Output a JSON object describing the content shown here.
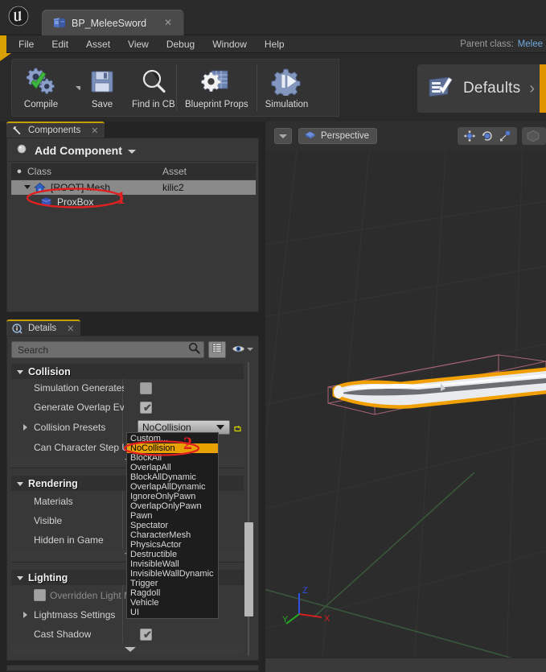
{
  "window": {
    "logo_icon": "unreal-engine-logo",
    "tab": {
      "label": "BP_MeleeSword",
      "icon": "blueprint-icon",
      "close_icon": "close-icon"
    }
  },
  "menubar": {
    "items": [
      {
        "label": "File"
      },
      {
        "label": "Edit"
      },
      {
        "label": "Asset"
      },
      {
        "label": "View"
      },
      {
        "label": "Debug"
      },
      {
        "label": "Window"
      },
      {
        "label": "Help"
      }
    ],
    "parent_class_label": "Parent class:",
    "parent_class_value": "Melee"
  },
  "toolbar": {
    "buttons": [
      {
        "label": "Compile",
        "icon": "compile-gears-check-icon"
      },
      {
        "label": "Save",
        "icon": "floppy-disk-icon"
      },
      {
        "label": "Find in CB",
        "icon": "magnifier-icon"
      },
      {
        "label": "Blueprint Props",
        "icon": "blueprint-properties-icon"
      },
      {
        "label": "Simulation",
        "icon": "simulation-gear-play-icon"
      }
    ],
    "defaults_label": "Defaults",
    "defaults_icon": "defaults-checklist-icon",
    "defaults_chevron": "›"
  },
  "components_panel": {
    "tab_label": "Components",
    "tab_icon": "wrench-icon",
    "close_icon": "close-icon",
    "add_component_label": "Add Component",
    "add_component_icon": "add-component-sphere-icon",
    "columns": {
      "class": "Class",
      "asset": "Asset"
    },
    "rows": [
      {
        "label": "[ROOT] Mesh",
        "asset": "kilic2",
        "icon": "mesh-home-icon",
        "selected": true,
        "indent": 0
      },
      {
        "label": "ProxBox",
        "asset": "",
        "icon": "box-collision-icon",
        "selected": false,
        "indent": 1
      }
    ]
  },
  "details_panel": {
    "tab_label": "Details",
    "tab_icon": "details-info-icon",
    "close_icon": "close-icon",
    "search": {
      "placeholder": "Search",
      "value": "",
      "icon": "search-icon"
    },
    "view_toggle_icon": "grid-view-icon",
    "visibility_icon": "eye-icon",
    "visibility_caret_icon": "chevron-down-icon",
    "categories": [
      {
        "title": "Collision",
        "properties": [
          {
            "label": "Simulation Generates I",
            "type": "checkbox",
            "checked": false
          },
          {
            "label": "Generate Overlap Even",
            "type": "checkbox",
            "checked": true
          },
          {
            "label": "Collision Presets",
            "type": "combo",
            "value": "NoCollision",
            "expandable": true,
            "reset_icon": "reset-arrow-icon"
          },
          {
            "label": "Can Character Step Up",
            "type": "none"
          }
        ]
      },
      {
        "title": "Rendering",
        "properties": [
          {
            "label": "Materials",
            "type": "none"
          },
          {
            "label": "Visible",
            "type": "none"
          },
          {
            "label": "Hidden in Game",
            "type": "none"
          }
        ]
      },
      {
        "title": "Lighting",
        "properties": [
          {
            "label": "Overridden Light M",
            "type": "checkbox",
            "checked": false,
            "dim": true
          },
          {
            "label": "Lightmass Settings",
            "type": "none",
            "expandable": true
          },
          {
            "label": "Cast Shadow",
            "type": "checkbox",
            "checked": true
          }
        ]
      }
    ]
  },
  "collision_dropdown": {
    "open": true,
    "selected": "NoCollision",
    "options": [
      "Custom...",
      "NoCollision",
      "BlockAll",
      "OverlapAll",
      "BlockAllDynamic",
      "OverlapAllDynamic",
      "IgnoreOnlyPawn",
      "OverlapOnlyPawn",
      "Pawn",
      "Spectator",
      "CharacterMesh",
      "PhysicsActor",
      "Destructible",
      "InvisibleWall",
      "InvisibleWallDynamic",
      "Trigger",
      "Ragdoll",
      "Vehicle",
      "UI"
    ]
  },
  "viewport": {
    "view_menu_icon": "chevron-down-icon",
    "perspective_label": "Perspective",
    "perspective_icon": "camera-cube-icon",
    "gizmo_buttons": [
      {
        "icon": "translate-gizmo-icon"
      },
      {
        "icon": "rotate-gizmo-icon"
      },
      {
        "icon": "scale-gizmo-icon"
      }
    ],
    "axis_labels": {
      "x": "X",
      "y": "Y",
      "z": "Z"
    },
    "axis_colors": {
      "x": "#d02020",
      "y": "#22b022",
      "z": "#3050e0"
    },
    "selection_outline_color": "#f0a000",
    "collision_wire_color": "#c06878",
    "mesh_color": "#e8eaee"
  },
  "annotations": [
    {
      "number": "1",
      "color": "#e02020",
      "target": "components-root-mesh-row"
    },
    {
      "number": "2",
      "color": "#e02020",
      "target": "dropdown-nocollision-option"
    }
  ]
}
